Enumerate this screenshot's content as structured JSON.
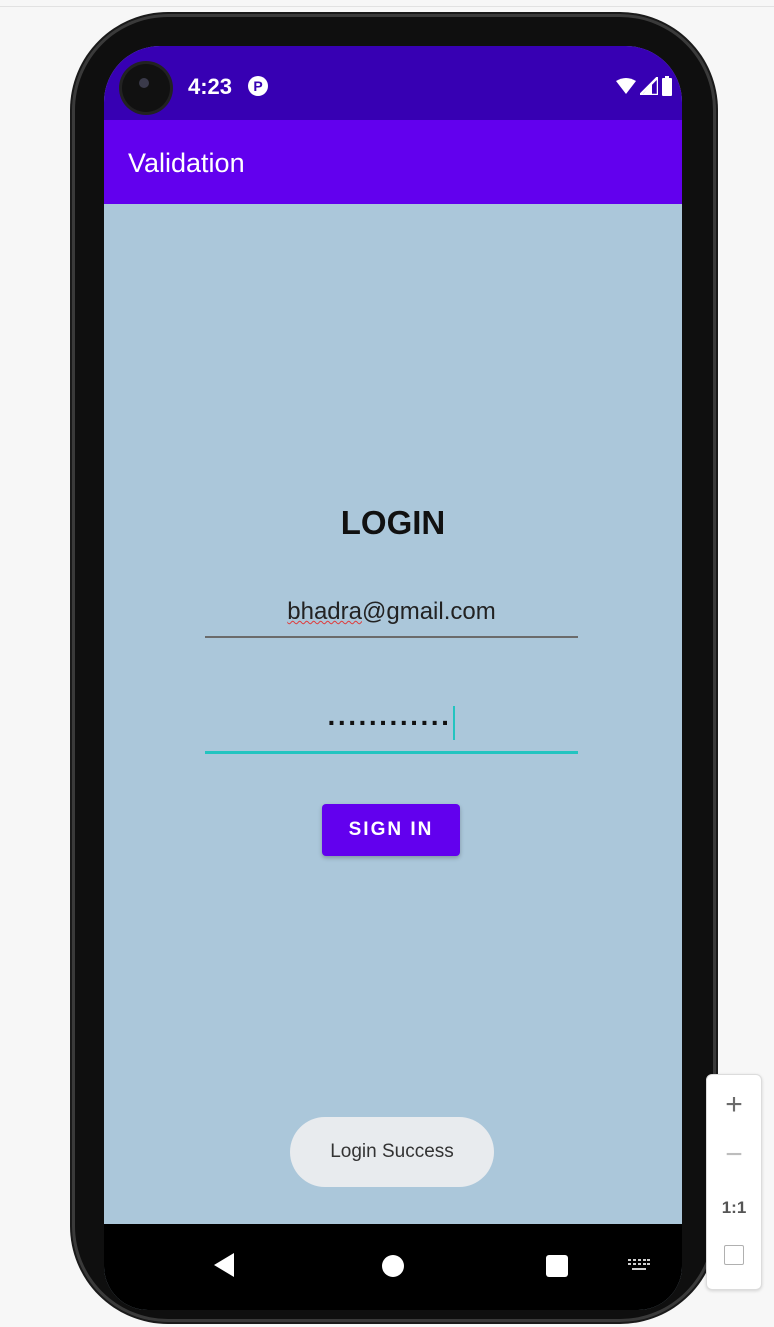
{
  "status_bar": {
    "time": "4:23",
    "notification_icon": "play-protect-icon",
    "icons": [
      "wifi-icon",
      "signal-icon",
      "battery-icon"
    ]
  },
  "app_bar": {
    "title": "Validation"
  },
  "login": {
    "heading": "LOGIN",
    "email_user": "bhadra",
    "email_domain": "@gmail.com",
    "password_masked": "············",
    "signin_label": "SIGN IN"
  },
  "toast": {
    "message": "Login Success"
  },
  "nav_bar": {
    "icons": [
      "back-icon",
      "home-icon",
      "recents-icon",
      "keyboard-icon"
    ]
  },
  "zoom_controls": {
    "zoom_in": "+",
    "zoom_out": "−",
    "actual_size": "1:1",
    "fit_icon": "fit-screen-icon"
  },
  "colors": {
    "status_bar": "#3700b3",
    "primary": "#6200ee",
    "background": "#abc7da",
    "accent": "#23c4c0"
  }
}
